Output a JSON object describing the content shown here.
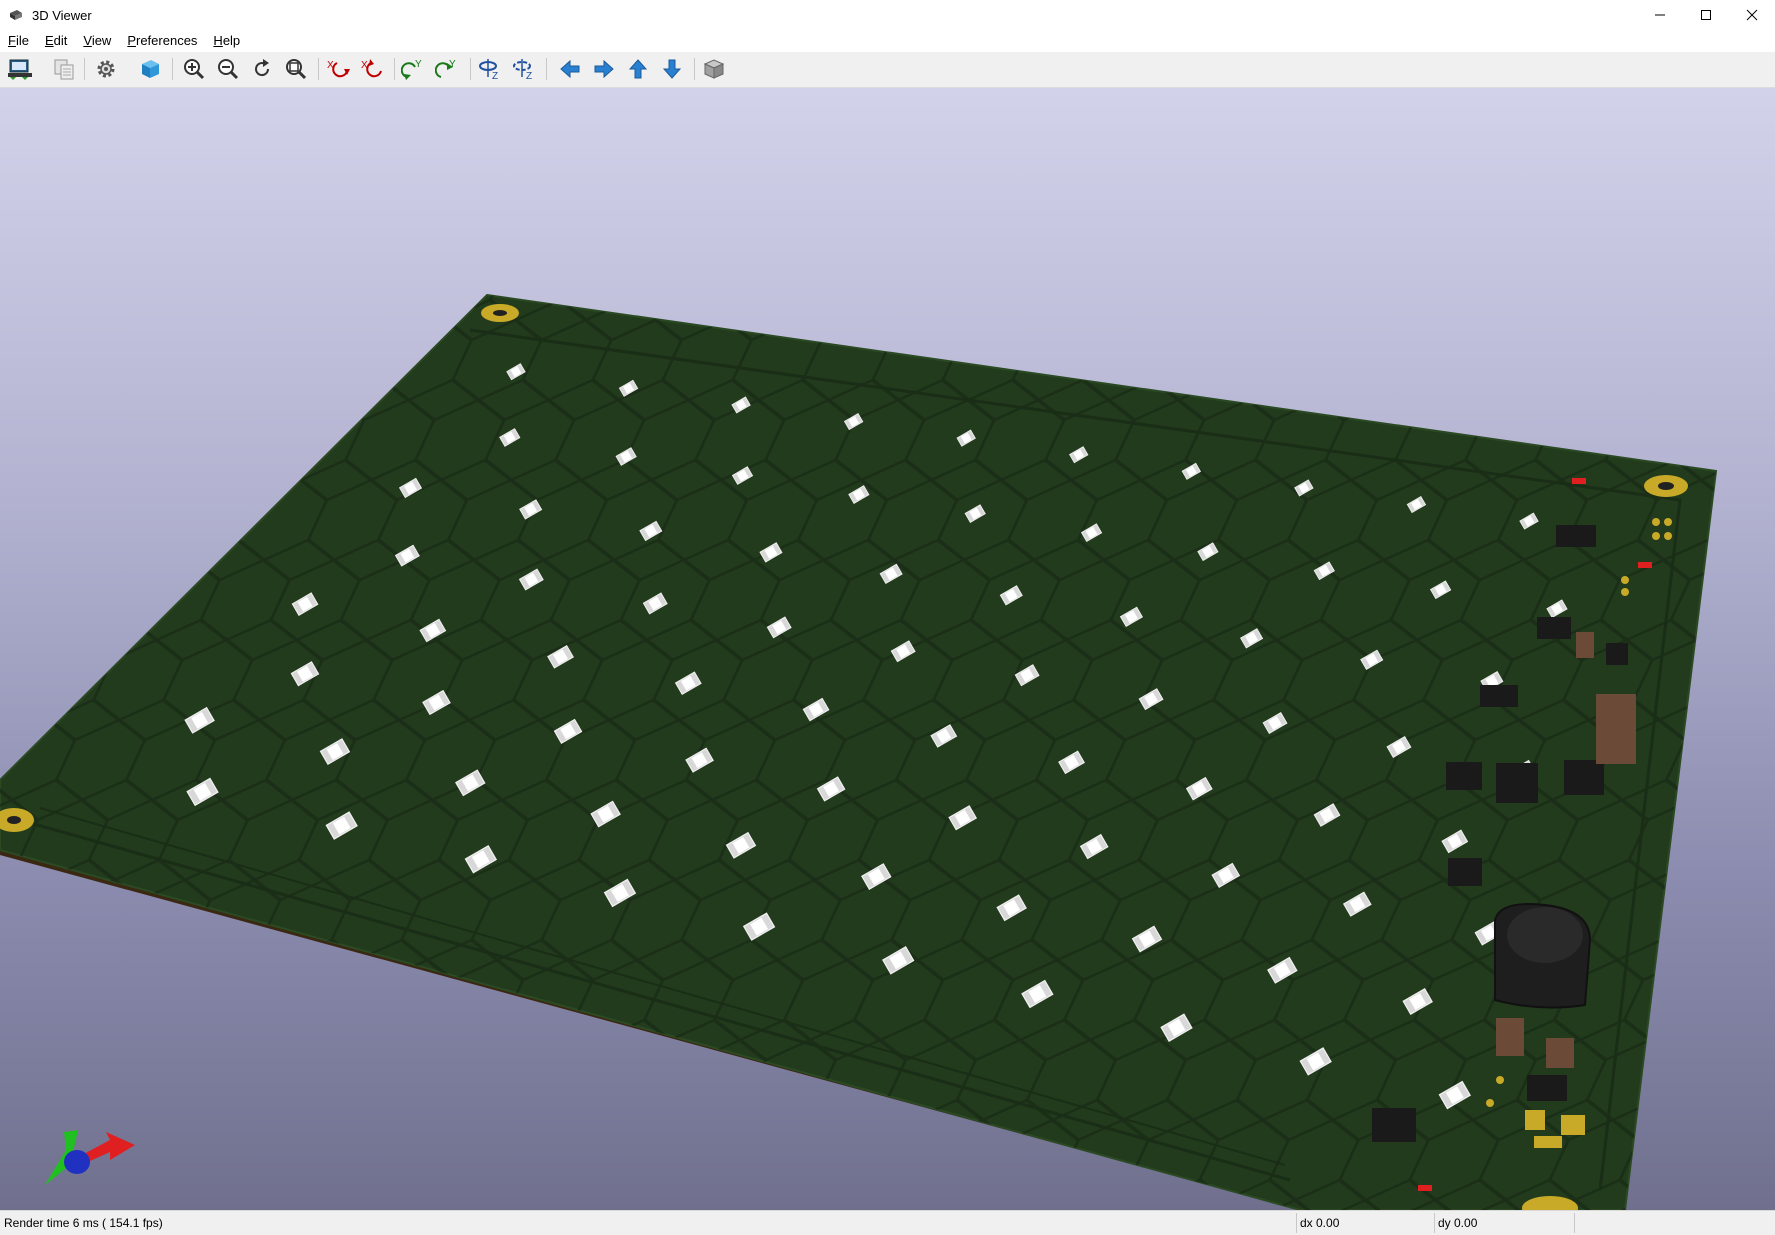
{
  "window": {
    "title": "3D Viewer",
    "icon": "kicad-3d-icon"
  },
  "window_controls": [
    "minimize-icon",
    "maximize-icon",
    "close-icon"
  ],
  "menu": {
    "file": {
      "u": "F",
      "rest": "ile"
    },
    "edit": {
      "u": "E",
      "rest": "dit"
    },
    "view": {
      "u": "V",
      "rest": "iew"
    },
    "preferences": {
      "u": "P",
      "rest": "references"
    },
    "help": {
      "u": "H",
      "rest": "elp"
    }
  },
  "toolbar": {
    "icons": [
      "reload-board-icon",
      "copy-image-icon",
      "settings-gear-icon",
      "raytrace-cube-icon",
      "zoom-in-icon",
      "zoom-out-icon",
      "redraw-icon",
      "zoom-fit-icon",
      "rotate-x-cw-icon",
      "rotate-x-ccw-icon",
      "rotate-y-cw-icon",
      "rotate-y-ccw-icon",
      "rotate-z-cw-icon",
      "rotate-z-ccw-icon",
      "move-left-icon",
      "move-right-icon",
      "move-up-icon",
      "move-down-icon",
      "ortho-toggle-icon"
    ]
  },
  "status": {
    "render_time": "Render time 6 ms ( 154.1 fps)",
    "dx": "dx 0.00",
    "dy": "dy 0.00"
  },
  "colors": {
    "pcb_surface": "#223b1c",
    "pcb_trace": "#1a2d16",
    "pcb_edge": "#3a2812",
    "pad_gold": "#c8aa28",
    "axis_x": "#e02020",
    "axis_y": "#20c020",
    "axis_z": "#2030c0"
  }
}
